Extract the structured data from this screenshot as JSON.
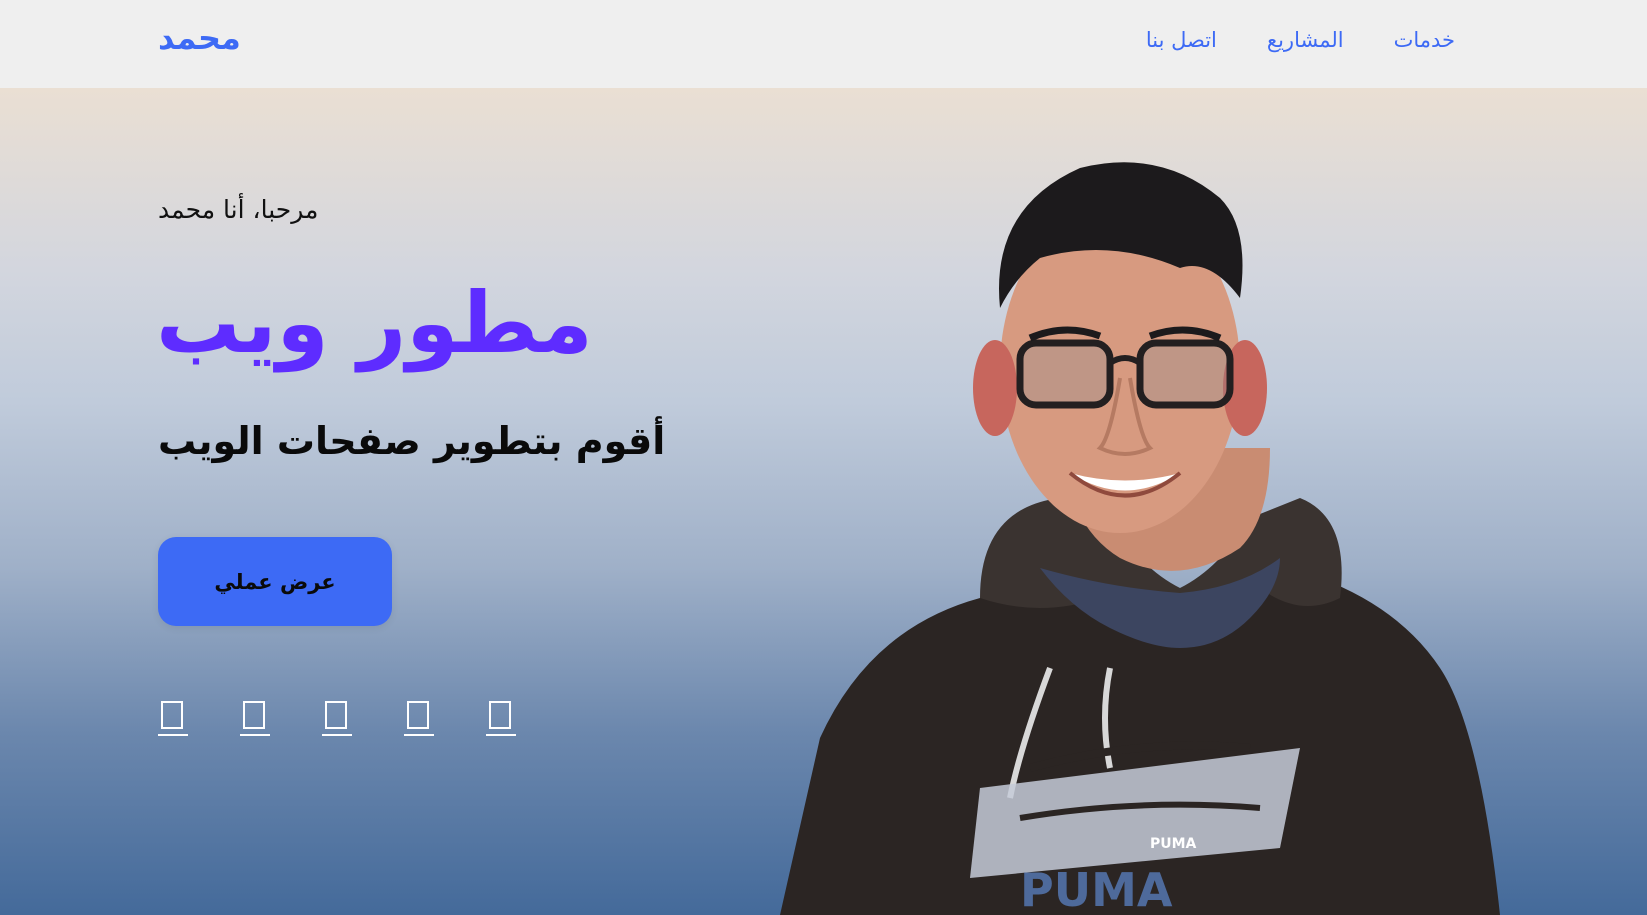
{
  "header": {
    "logo": "محمد",
    "nav": [
      {
        "label": "خدمات"
      },
      {
        "label": "المشاريع"
      },
      {
        "label": "اتصل بنا"
      }
    ]
  },
  "hero": {
    "greeting": "مرحبا، أنا محمد",
    "title": "مطور ويب",
    "subtitle": "أقوم بتطوير صفحات الويب",
    "cta_label": "عرض عملي",
    "socials": [
      {
        "icon": "social-icon-1"
      },
      {
        "icon": "social-icon-2"
      },
      {
        "icon": "social-icon-3"
      },
      {
        "icon": "social-icon-4"
      },
      {
        "icon": "social-icon-5"
      }
    ],
    "portrait": {
      "shirt_text_main": "PUMA",
      "shirt_text_small": "PUMA"
    }
  },
  "colors": {
    "accent": "#3d6af5",
    "title": "#5e2cff",
    "header_bg": "#efefef"
  }
}
